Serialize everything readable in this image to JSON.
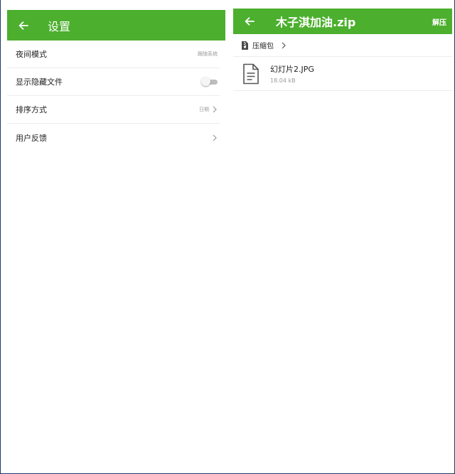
{
  "settings_screen": {
    "title": "设置",
    "items": [
      {
        "label": "夜间模式",
        "value": "跟随系统"
      },
      {
        "label": "显示隐藏文件",
        "toggle_on": false
      },
      {
        "label": "排序方式",
        "value": "日期"
      },
      {
        "label": "用户反馈"
      }
    ]
  },
  "archive_screen": {
    "title": "木子淇加油.zip",
    "extract_label": "解压",
    "breadcrumb": {
      "label": "压缩包"
    },
    "files": [
      {
        "name": "幻灯片2.JPG",
        "size": "18.04 kB"
      }
    ]
  },
  "colors": {
    "app_bar": "#4caf2e",
    "frame_border": "#1c3a6a",
    "secondary_text": "#9a9a9a"
  },
  "icons": {
    "back": "arrow-left-icon",
    "chevron": "chevron-right-icon",
    "archive": "archive-icon",
    "file": "document-icon"
  }
}
